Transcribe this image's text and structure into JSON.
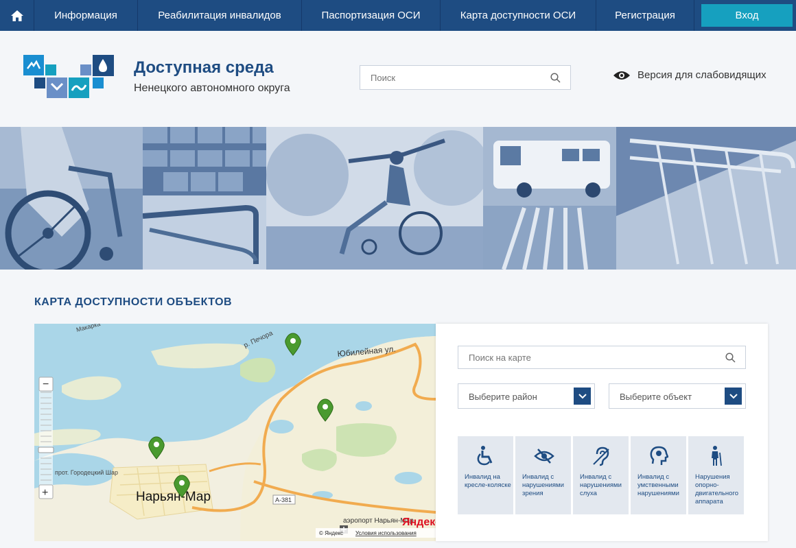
{
  "nav": {
    "items": [
      "Информация",
      "Реабилитация инвалидов",
      "Паспортизация ОСИ",
      "Карта доступности ОСИ",
      "Регистрация"
    ],
    "login": "Вход"
  },
  "header": {
    "title": "Доступная среда",
    "subtitle": "Ненецкого автономного округа",
    "search_placeholder": "Поиск",
    "vision_link": "Версия для слабовидящих"
  },
  "section": {
    "title": "КАРТА ДОСТУПНОСТИ ОБЪЕКТОВ"
  },
  "map": {
    "city_label": "Нарьян-Мар",
    "street_label": "Юбилейная ул.",
    "river_label": "р. Печора",
    "road_label": "А-381",
    "airport_label": "аэропорт Нарьян-Мар",
    "village_label": "прот. Городецкий Шар",
    "makar_label": "Макарка",
    "copyright": "© Яндекс",
    "terms": "Условия использования",
    "brand": "Яндекс",
    "zoom_in": "+",
    "zoom_out": "−"
  },
  "sidebar": {
    "search_placeholder": "Поиск на карте",
    "district_select": "Выберите район",
    "object_select": "Выберите объект",
    "categories": [
      {
        "icon": "wheelchair-icon",
        "label": "Инвалид на кресле-коляске"
      },
      {
        "icon": "eye-icon",
        "label": "Инвалид с нарушениями зрения"
      },
      {
        "icon": "ear-icon",
        "label": "Инвалид с нарушениями слуха"
      },
      {
        "icon": "head-icon",
        "label": "Инвалид с умственными нарушениями"
      },
      {
        "icon": "person-icon",
        "label": "Нарушения опорно-двигательного аппарата"
      }
    ]
  },
  "colors": {
    "nav_bg": "#1e4c82",
    "login_bg": "#16a0bf",
    "accent": "#1e4c82",
    "marker": "#4a9a2f"
  }
}
